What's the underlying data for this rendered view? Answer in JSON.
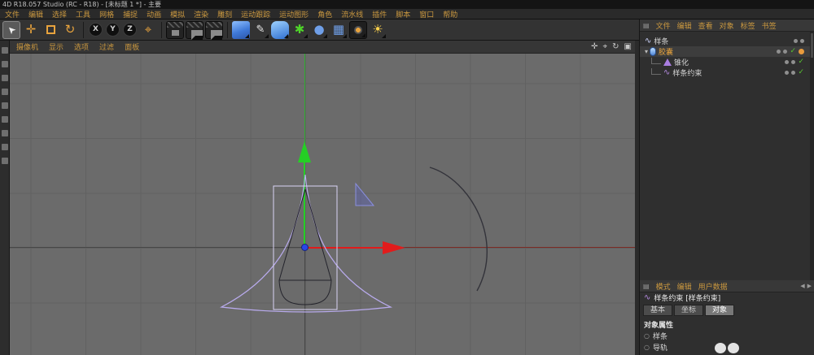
{
  "window": {
    "title": "4D R18.057 Studio (RC - R18) - [未标题 1 *] - 主要"
  },
  "menu_bar": {
    "items": [
      "文件",
      "编辑",
      "选择",
      "工具",
      "网格",
      "捕捉",
      "动画",
      "模拟",
      "渲染",
      "雕刻",
      "运动跟踪",
      "运动图形",
      "角色",
      "流水线",
      "插件",
      "脚本",
      "窗口",
      "帮助"
    ]
  },
  "toolbar": {
    "axis_locks": [
      "X",
      "Y",
      "Z"
    ]
  },
  "viewport": {
    "menu_items": [
      "摄像机",
      "显示",
      "选项",
      "过滤",
      "面板"
    ]
  },
  "object_manager": {
    "menu_items": [
      "文件",
      "编辑",
      "查看",
      "对象",
      "标签",
      "书签"
    ],
    "objects": [
      {
        "label": "样条",
        "type": "spline"
      },
      {
        "label": "胶囊",
        "type": "capsule",
        "selected": true,
        "checked": true
      },
      {
        "label": "锥化",
        "type": "taper",
        "child": true,
        "checked": true
      },
      {
        "label": "样条约束",
        "type": "spline-wrap",
        "child": true,
        "checked": true
      }
    ]
  },
  "attribute_manager": {
    "menu_items": [
      "模式",
      "编辑",
      "用户数据"
    ],
    "object_title": "样条约束 [样条约束]",
    "tabs": [
      {
        "label": "基本"
      },
      {
        "label": "坐标"
      },
      {
        "label": "对象",
        "active": true
      }
    ],
    "section_title": "对象属性",
    "properties": [
      {
        "label": "样条"
      },
      {
        "label": "导轨"
      }
    ]
  },
  "glyphs": {
    "cursor": "➤",
    "move": "✛",
    "rotate": "↻",
    "coords": "⌖",
    "pen": "✎",
    "spline": "∿",
    "gear": "✱",
    "sphere": "●",
    "floor": "▦",
    "light": "☀",
    "pan": "✛",
    "zoom": "⌖",
    "rotate_view": "↻",
    "toggle_view": "▣",
    "check": "✓",
    "bullet": "○",
    "tree_collapse": "▾",
    "panel_menu": "▤",
    "arrow_left": "◀",
    "arrow_right": "▶"
  },
  "colors": {
    "accent_text": "#c9973f",
    "axis_red": "#e11c1c",
    "axis_green": "#25cf25",
    "axis_blue": "#2a46e8",
    "spline_purple": "#b9abee",
    "selection_box": "#d9d3f5",
    "check_green": "#58c431",
    "viewport_bg": "#6b6b6b"
  }
}
